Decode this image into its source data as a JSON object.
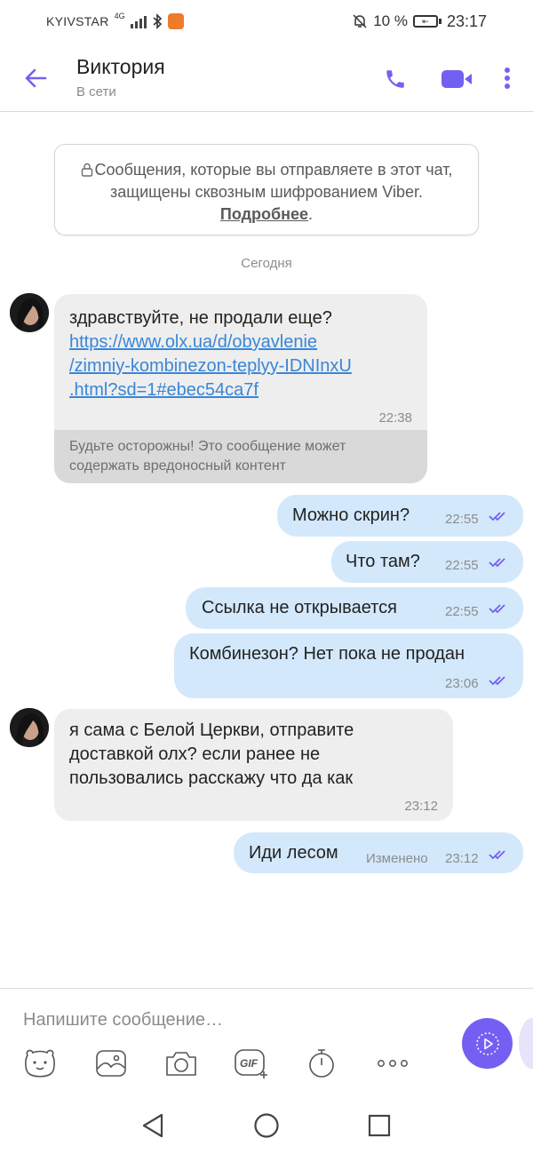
{
  "status_bar": {
    "carrier": "KYIVSTAR",
    "network": "4G",
    "battery": "10 %",
    "time": "23:17"
  },
  "header": {
    "contact_name": "Виктория",
    "contact_status": "В сети",
    "icons": [
      "back-arrow-icon",
      "phone-icon",
      "video-icon",
      "more-vert-icon"
    ]
  },
  "notice": {
    "text": "Сообщения, которые вы отправляете в этот чат, защищены сквозным шифрованием Viber. ",
    "link": "Подробнее",
    "end": "."
  },
  "date_separator": "Сегодня",
  "messages": [
    {
      "direction": "in",
      "text": "здравствуйте, не продали еще?",
      "link": "https://www.olx.ua/d/obyavlenie\n/zimniy-kombinezon-teplyy-IDNInxU\n.html?sd=1#ebec54ca7f",
      "time": "22:38",
      "warning": "Будьте осторожны! Это сообщение может содержать вредоносный контент"
    },
    {
      "direction": "out",
      "text": "Можно скрин?",
      "time": "22:55",
      "read": true
    },
    {
      "direction": "out",
      "text": "Что там?",
      "time": "22:55",
      "read": true
    },
    {
      "direction": "out",
      "text": "Ссылка не открывается",
      "time": "22:55",
      "read": true
    },
    {
      "direction": "out",
      "text": "Комбинезон? Нет пока не продан",
      "time": "23:06",
      "read": true
    },
    {
      "direction": "in",
      "text": "я сама с Белой Церкви, отправите\nдоставкой олх? если ранее не\nпользовались расскажу что да как",
      "time": "23:12"
    },
    {
      "direction": "out",
      "text": "Иди лесом",
      "edited": "Изменено",
      "time": "23:12",
      "read": true
    }
  ],
  "composer": {
    "placeholder": "Напишите сообщение…",
    "tools": [
      "sticker-icon",
      "gallery-icon",
      "camera-icon",
      "gif-icon",
      "timer-icon",
      "more-horiz-icon"
    ],
    "gif_label": "GIF"
  },
  "colors": {
    "accent": "#7360f2",
    "outgoing_bubble": "#d3e8fb",
    "incoming_bubble": "#eeeeee",
    "link": "#3a86d6"
  }
}
